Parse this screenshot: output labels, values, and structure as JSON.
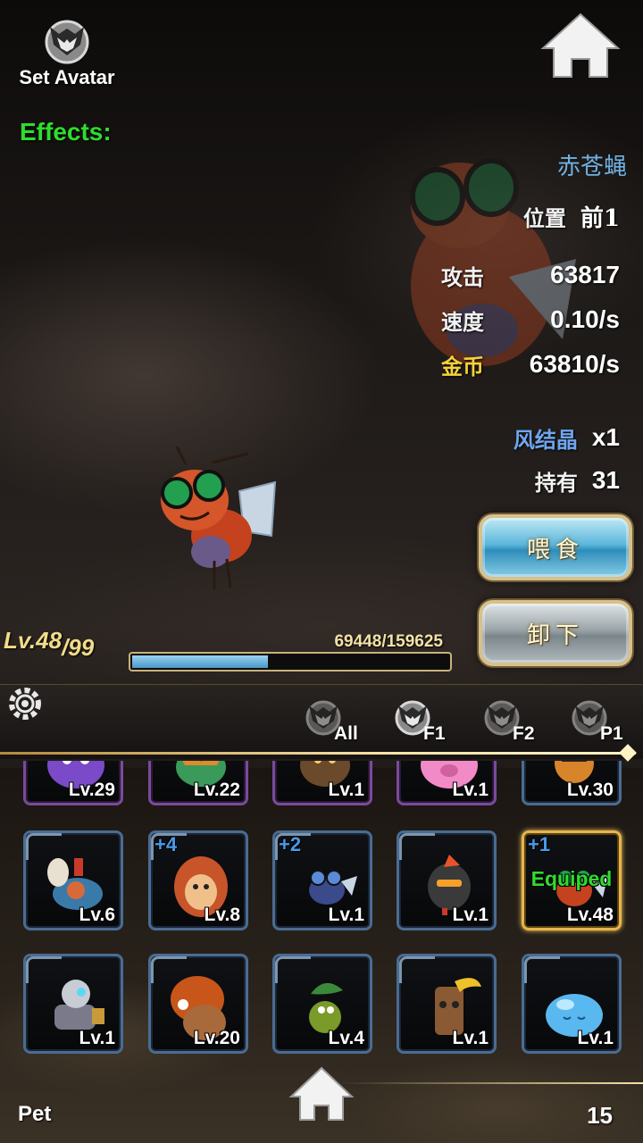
{
  "header": {
    "avatar_label": "Set Avatar",
    "avatar_icon": "wolf-head-icon",
    "home_icon": "home-icon",
    "effects_label": "Effects:"
  },
  "pet": {
    "name": "赤苍蝇",
    "position_label": "位置",
    "position_value": "前1",
    "attack_label": "攻击",
    "attack_value": "63817",
    "speed_label": "速度",
    "speed_value": "0.10/s",
    "gold_label": "金币",
    "gold_value": "63810/s",
    "crystal_label": "风结晶",
    "crystal_value": "x1",
    "owned_label": "持有",
    "owned_value": "31"
  },
  "buttons": {
    "feed": "喂食",
    "unload": "卸下"
  },
  "progress": {
    "level": "Lv.48",
    "max_level": "/99",
    "exp_text": "69448/159625",
    "exp_fraction": 0.435
  },
  "filter": {
    "settings_icon": "gear-icon",
    "tabs": [
      {
        "label": "All",
        "active": false
      },
      {
        "label": "F1",
        "active": true
      },
      {
        "label": "F2",
        "active": false
      },
      {
        "label": "P1",
        "active": false
      }
    ]
  },
  "grid": {
    "rows": [
      [
        {
          "level": "Lv.29",
          "plus": "",
          "equipped": false,
          "frame": "purple",
          "art": "purple-blob"
        },
        {
          "level": "Lv.22",
          "plus": "",
          "equipped": false,
          "frame": "purple",
          "art": "green-plant"
        },
        {
          "level": "Lv.1",
          "plus": "",
          "equipped": false,
          "frame": "purple",
          "art": "brown-beast"
        },
        {
          "level": "Lv.1",
          "plus": "",
          "equipped": false,
          "frame": "purple",
          "art": "pink-pig"
        },
        {
          "level": "Lv.30",
          "plus": "",
          "equipped": false,
          "frame": "blue",
          "art": "orange-cat"
        }
      ],
      [
        {
          "level": "Lv.6",
          "plus": "",
          "equipped": false,
          "frame": "blue",
          "art": "crab"
        },
        {
          "level": "Lv.8",
          "plus": "+4",
          "equipped": false,
          "frame": "blue",
          "art": "dino-suit"
        },
        {
          "level": "Lv.1",
          "plus": "+2",
          "equipped": false,
          "frame": "blue",
          "art": "blue-fly"
        },
        {
          "level": "Lv.1",
          "plus": "",
          "equipped": false,
          "frame": "blue",
          "art": "dark-bird"
        },
        {
          "level": "Lv.48",
          "plus": "+1",
          "equipped": true,
          "frame": "gold",
          "art": "red-fly"
        }
      ],
      [
        {
          "level": "Lv.1",
          "plus": "",
          "equipped": false,
          "frame": "blue",
          "art": "robot"
        },
        {
          "level": "Lv.20",
          "plus": "",
          "equipped": false,
          "frame": "blue",
          "art": "orange-mole"
        },
        {
          "level": "Lv.4",
          "plus": "",
          "equipped": false,
          "frame": "blue",
          "art": "green-caterpillar"
        },
        {
          "level": "Lv.1",
          "plus": "",
          "equipped": false,
          "frame": "blue",
          "art": "tree-stump"
        },
        {
          "level": "Lv.1",
          "plus": "",
          "equipped": false,
          "frame": "blue",
          "art": "blue-slime"
        }
      ]
    ],
    "equipped_tag": "Equiped"
  },
  "footer": {
    "label": "Pet",
    "count": "15",
    "home_icon": "home-icon"
  },
  "colors": {
    "effects_green": "#2fdc2f",
    "gold_text": "#f4d23a",
    "name_blue": "#6fb0e0",
    "frame_blue": "#4a6c92",
    "frame_gold": "#e7b64a"
  }
}
